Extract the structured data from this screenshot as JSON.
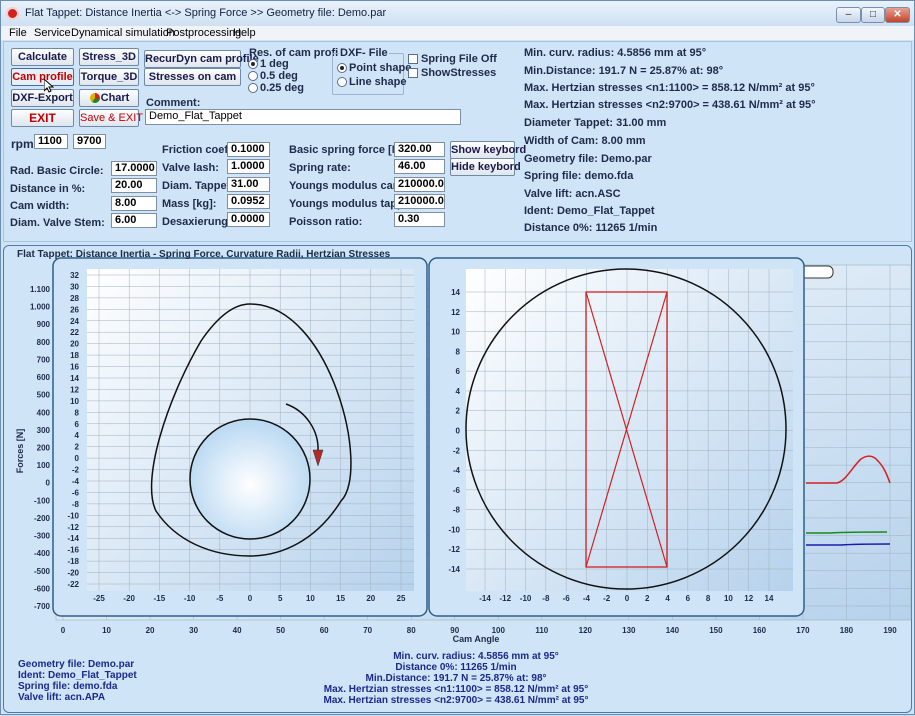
{
  "window": {
    "title": "Flat Tappet: Distance Inertia <-> Spring Force >> Geometry file: Demo.par",
    "min": "–",
    "max": "□",
    "close": "✕"
  },
  "menu": [
    "File",
    "Service",
    "Dynamical simulation",
    "Postprocessing",
    "Help"
  ],
  "buttons": {
    "calculate": "Calculate",
    "stress3d": "Stress_3D",
    "recurdyn": "RecurDyn cam profile",
    "cam_profile": "Cam profile",
    "torque3d": "Torque_3D",
    "stresses_cam": "Stresses on cam",
    "dxf_export": "DXF-Export",
    "chart": "Chart",
    "exit": "EXIT",
    "save_exit": "Save & EXIT",
    "show_keyboard": "Show keybord",
    "hide_keyboard": "Hide keybord"
  },
  "resolution": {
    "title": "Res. of cam profile",
    "options": [
      "1 deg",
      "0.5 deg",
      "0.25 deg"
    ],
    "selected": 0
  },
  "dxf": {
    "title": "DXF- File",
    "options": [
      "Point shape",
      "Line shape"
    ],
    "selected": 0
  },
  "checks": {
    "spring_file_off": "Spring File Off",
    "show_stresses": "ShowStresses"
  },
  "comment": {
    "label": "Comment:",
    "value": "Demo_Flat_Tappet"
  },
  "rpm": {
    "label": "rpm:",
    "v1": "1100",
    "v2": "9700"
  },
  "params_left": [
    {
      "label": "Rad. Basic Circle:",
      "value": "17.0000"
    },
    {
      "label": "Distance in %:",
      "value": "20.00"
    },
    {
      "label": "Cam width:",
      "value": "8.00"
    },
    {
      "label": "Diam. Valve Stem:",
      "value": "6.00"
    }
  ],
  "params_mid": [
    {
      "label": "Friction coeff.:",
      "value": "0.1000"
    },
    {
      "label": "Valve lash:",
      "value": "1.0000"
    },
    {
      "label": "Diam. Tappet:",
      "value": "31.00"
    },
    {
      "label": "Mass [kg]:",
      "value": "0.0952"
    },
    {
      "label": "Desaxierung:",
      "value": "0.0000"
    }
  ],
  "params_right": [
    {
      "label": "Basic spring force [N]:",
      "value": "320.00"
    },
    {
      "label": "Spring rate:",
      "value": "46.00"
    },
    {
      "label": "Youngs modulus cam:",
      "value": "210000.0"
    },
    {
      "label": "Youngs modulus tappet:",
      "value": "210000.0"
    },
    {
      "label": "Poisson ratio:",
      "value": "0.30"
    }
  ],
  "info": [
    "Min. curv. radius: 4.5856 mm at 95°",
    "Min.Distance: 191.7 N = 25.87% at: 98°",
    "Max. Hertzian stresses <n1:1100> = 858.12 N/mm² at  95°",
    "Max. Hertzian stresses <n2:9700> = 438.61 N/mm² at  95°",
    "Diameter Tappet:  31.00 mm",
    "Width of Cam:      8.00 mm",
    "Geometry file:  Demo.par",
    "Spring file: demo.fda",
    "Valve lift: acn.ASC",
    "Ident:  Demo_Flat_Tappet",
    "Distance 0%: 11265 1/min"
  ],
  "plot": {
    "title": "Flat Tappet: Distance Inertia - Spring Force, Curvature Radii, Hertzian Stresses",
    "ylabel": "Forces [N]",
    "xlabel": "Cam Angle",
    "yticks": [
      "1.100",
      "1.000",
      "900",
      "800",
      "700",
      "600",
      "500",
      "400",
      "300",
      "200",
      "100",
      "0",
      "-100",
      "-200",
      "-300",
      "-400",
      "-500",
      "-600",
      "-700"
    ],
    "xticks": [
      "0",
      "10",
      "20",
      "30",
      "40",
      "50",
      "60",
      "70",
      "80",
      "90",
      "100",
      "110",
      "120",
      "130",
      "140",
      "150",
      "160",
      "170",
      "180",
      "190"
    ]
  },
  "cam_view": {
    "yticks": [
      "32",
      "30",
      "28",
      "26",
      "24",
      "22",
      "20",
      "18",
      "16",
      "14",
      "12",
      "10",
      "8",
      "6",
      "4",
      "2",
      "0",
      "-2",
      "-4",
      "-6",
      "-8",
      "-10",
      "-12",
      "-14",
      "-16",
      "-18",
      "-20",
      "-22"
    ],
    "xticks": [
      "-25",
      "-20",
      "-15",
      "-10",
      "-5",
      "0",
      "5",
      "10",
      "15",
      "20",
      "25"
    ]
  },
  "tappet_view": {
    "yticks": [
      "14",
      "12",
      "10",
      "8",
      "6",
      "4",
      "2",
      "0",
      "-2",
      "-4",
      "-6",
      "-8",
      "-10",
      "-12",
      "-14"
    ],
    "xticks": [
      "-14",
      "-12",
      "-10",
      "-8",
      "-6",
      "-4",
      "-2",
      "0",
      "2",
      "4",
      "6",
      "8",
      "10",
      "12",
      "14"
    ]
  },
  "bottom_left": [
    "Geometry file:  Demo.par",
    "Ident:  Demo_Flat_Tappet",
    "Spring file: demo.fda",
    "Valve lift: acn.APA"
  ],
  "bottom_center": [
    "Min. curv. radius: 4.5856 mm at 95°",
    "Distance 0%: 11265 1/min",
    "Min.Distance: 191.7 N = 25.87% at: 98°",
    "Max. Hertzian stresses <n1:1100> = 858.12 N/mm² at  95°",
    "Max. Hertzian stresses <n2:9700> = 438.61 N/mm² at  95°"
  ],
  "colors": {
    "curve_red": "#d42020",
    "curve_green": "#1a8a1a",
    "curve_blue": "#1a1ab0",
    "arrow_red": "#b02a2a"
  }
}
